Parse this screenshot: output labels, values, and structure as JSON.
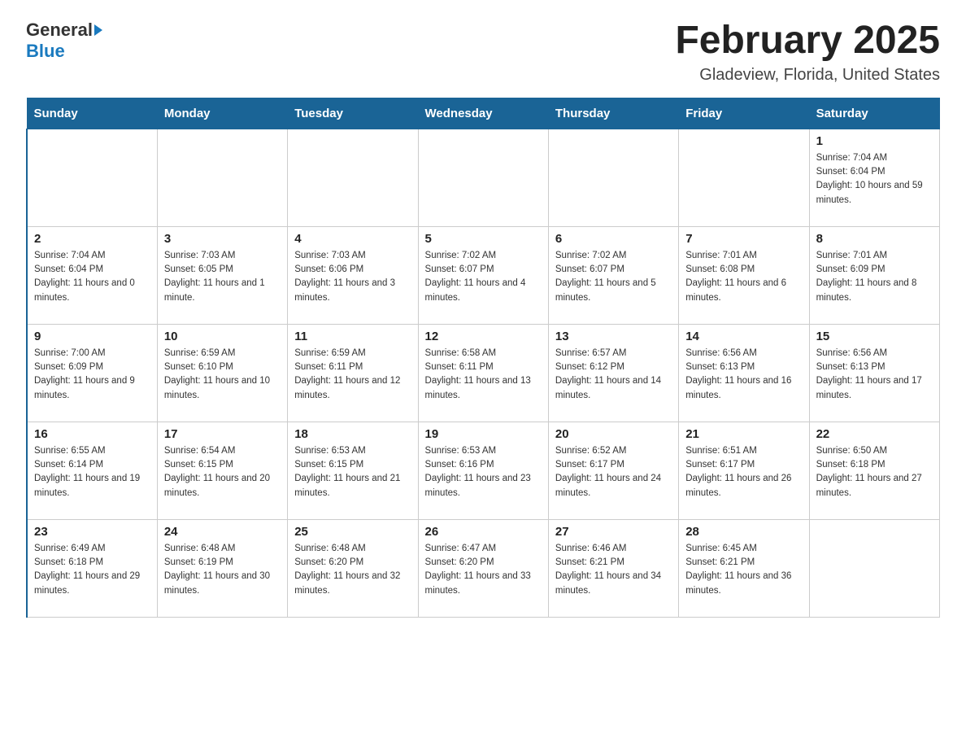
{
  "logo": {
    "text_general": "General",
    "text_blue": "Blue"
  },
  "header": {
    "title": "February 2025",
    "subtitle": "Gladeview, Florida, United States"
  },
  "days_of_week": [
    "Sunday",
    "Monday",
    "Tuesday",
    "Wednesday",
    "Thursday",
    "Friday",
    "Saturday"
  ],
  "weeks": [
    [
      {
        "day": "",
        "sunrise": "",
        "sunset": "",
        "daylight": ""
      },
      {
        "day": "",
        "sunrise": "",
        "sunset": "",
        "daylight": ""
      },
      {
        "day": "",
        "sunrise": "",
        "sunset": "",
        "daylight": ""
      },
      {
        "day": "",
        "sunrise": "",
        "sunset": "",
        "daylight": ""
      },
      {
        "day": "",
        "sunrise": "",
        "sunset": "",
        "daylight": ""
      },
      {
        "day": "",
        "sunrise": "",
        "sunset": "",
        "daylight": ""
      },
      {
        "day": "1",
        "sunrise": "Sunrise: 7:04 AM",
        "sunset": "Sunset: 6:04 PM",
        "daylight": "Daylight: 10 hours and 59 minutes."
      }
    ],
    [
      {
        "day": "2",
        "sunrise": "Sunrise: 7:04 AM",
        "sunset": "Sunset: 6:04 PM",
        "daylight": "Daylight: 11 hours and 0 minutes."
      },
      {
        "day": "3",
        "sunrise": "Sunrise: 7:03 AM",
        "sunset": "Sunset: 6:05 PM",
        "daylight": "Daylight: 11 hours and 1 minute."
      },
      {
        "day": "4",
        "sunrise": "Sunrise: 7:03 AM",
        "sunset": "Sunset: 6:06 PM",
        "daylight": "Daylight: 11 hours and 3 minutes."
      },
      {
        "day": "5",
        "sunrise": "Sunrise: 7:02 AM",
        "sunset": "Sunset: 6:07 PM",
        "daylight": "Daylight: 11 hours and 4 minutes."
      },
      {
        "day": "6",
        "sunrise": "Sunrise: 7:02 AM",
        "sunset": "Sunset: 6:07 PM",
        "daylight": "Daylight: 11 hours and 5 minutes."
      },
      {
        "day": "7",
        "sunrise": "Sunrise: 7:01 AM",
        "sunset": "Sunset: 6:08 PM",
        "daylight": "Daylight: 11 hours and 6 minutes."
      },
      {
        "day": "8",
        "sunrise": "Sunrise: 7:01 AM",
        "sunset": "Sunset: 6:09 PM",
        "daylight": "Daylight: 11 hours and 8 minutes."
      }
    ],
    [
      {
        "day": "9",
        "sunrise": "Sunrise: 7:00 AM",
        "sunset": "Sunset: 6:09 PM",
        "daylight": "Daylight: 11 hours and 9 minutes."
      },
      {
        "day": "10",
        "sunrise": "Sunrise: 6:59 AM",
        "sunset": "Sunset: 6:10 PM",
        "daylight": "Daylight: 11 hours and 10 minutes."
      },
      {
        "day": "11",
        "sunrise": "Sunrise: 6:59 AM",
        "sunset": "Sunset: 6:11 PM",
        "daylight": "Daylight: 11 hours and 12 minutes."
      },
      {
        "day": "12",
        "sunrise": "Sunrise: 6:58 AM",
        "sunset": "Sunset: 6:11 PM",
        "daylight": "Daylight: 11 hours and 13 minutes."
      },
      {
        "day": "13",
        "sunrise": "Sunrise: 6:57 AM",
        "sunset": "Sunset: 6:12 PM",
        "daylight": "Daylight: 11 hours and 14 minutes."
      },
      {
        "day": "14",
        "sunrise": "Sunrise: 6:56 AM",
        "sunset": "Sunset: 6:13 PM",
        "daylight": "Daylight: 11 hours and 16 minutes."
      },
      {
        "day": "15",
        "sunrise": "Sunrise: 6:56 AM",
        "sunset": "Sunset: 6:13 PM",
        "daylight": "Daylight: 11 hours and 17 minutes."
      }
    ],
    [
      {
        "day": "16",
        "sunrise": "Sunrise: 6:55 AM",
        "sunset": "Sunset: 6:14 PM",
        "daylight": "Daylight: 11 hours and 19 minutes."
      },
      {
        "day": "17",
        "sunrise": "Sunrise: 6:54 AM",
        "sunset": "Sunset: 6:15 PM",
        "daylight": "Daylight: 11 hours and 20 minutes."
      },
      {
        "day": "18",
        "sunrise": "Sunrise: 6:53 AM",
        "sunset": "Sunset: 6:15 PM",
        "daylight": "Daylight: 11 hours and 21 minutes."
      },
      {
        "day": "19",
        "sunrise": "Sunrise: 6:53 AM",
        "sunset": "Sunset: 6:16 PM",
        "daylight": "Daylight: 11 hours and 23 minutes."
      },
      {
        "day": "20",
        "sunrise": "Sunrise: 6:52 AM",
        "sunset": "Sunset: 6:17 PM",
        "daylight": "Daylight: 11 hours and 24 minutes."
      },
      {
        "day": "21",
        "sunrise": "Sunrise: 6:51 AM",
        "sunset": "Sunset: 6:17 PM",
        "daylight": "Daylight: 11 hours and 26 minutes."
      },
      {
        "day": "22",
        "sunrise": "Sunrise: 6:50 AM",
        "sunset": "Sunset: 6:18 PM",
        "daylight": "Daylight: 11 hours and 27 minutes."
      }
    ],
    [
      {
        "day": "23",
        "sunrise": "Sunrise: 6:49 AM",
        "sunset": "Sunset: 6:18 PM",
        "daylight": "Daylight: 11 hours and 29 minutes."
      },
      {
        "day": "24",
        "sunrise": "Sunrise: 6:48 AM",
        "sunset": "Sunset: 6:19 PM",
        "daylight": "Daylight: 11 hours and 30 minutes."
      },
      {
        "day": "25",
        "sunrise": "Sunrise: 6:48 AM",
        "sunset": "Sunset: 6:20 PM",
        "daylight": "Daylight: 11 hours and 32 minutes."
      },
      {
        "day": "26",
        "sunrise": "Sunrise: 6:47 AM",
        "sunset": "Sunset: 6:20 PM",
        "daylight": "Daylight: 11 hours and 33 minutes."
      },
      {
        "day": "27",
        "sunrise": "Sunrise: 6:46 AM",
        "sunset": "Sunset: 6:21 PM",
        "daylight": "Daylight: 11 hours and 34 minutes."
      },
      {
        "day": "28",
        "sunrise": "Sunrise: 6:45 AM",
        "sunset": "Sunset: 6:21 PM",
        "daylight": "Daylight: 11 hours and 36 minutes."
      },
      {
        "day": "",
        "sunrise": "",
        "sunset": "",
        "daylight": ""
      }
    ]
  ]
}
